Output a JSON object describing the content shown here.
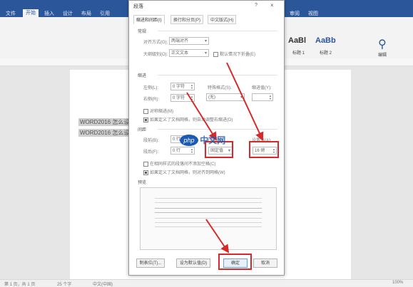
{
  "ribbon": {
    "tabs": [
      "文件",
      "开始",
      "插入",
      "设计",
      "布局",
      "引用",
      "邮件",
      "审阅",
      "视图"
    ],
    "active_tab": "开始",
    "styles": [
      {
        "sample": "AaBl",
        "caption": "标题 1"
      },
      {
        "sample": "AaBb",
        "caption": "标题 2"
      }
    ],
    "right_button": "编辑"
  },
  "document": {
    "lines": [
      "WORD2016 怎么设",
      "WORD2016 怎么设"
    ]
  },
  "dialog": {
    "title": "段落",
    "help": "?",
    "close": "×",
    "tabs": [
      "缩进和间距(I)",
      "换行和分页(P)",
      "中文版式(H)"
    ],
    "general": {
      "section": "常规",
      "alignment_label": "对齐方式(G):",
      "alignment_value": "两端对齐",
      "outline_label": "大纲级别(O):",
      "outline_value": "正文文本",
      "collapse_label": "默认情况下折叠(E)"
    },
    "indent": {
      "section": "缩进",
      "left_label": "左侧(L):",
      "left_value": "0 字符",
      "right_label": "右侧(R):",
      "right_value": "0 字符",
      "special_label": "特殊格式(S):",
      "special_value": "(无)",
      "by_label": "缩进值(Y):",
      "mirror_label": "对称缩进(M)",
      "grid_label": "如果定义了文档网格，则自动调整右缩进(D)"
    },
    "spacing": {
      "section": "间距",
      "before_label": "段前(B):",
      "before_value": "0 行",
      "after_label": "段后(F):",
      "after_value": "0 行",
      "line_label": "行距(N):",
      "line_value": "固定值",
      "at_label": "设置值(A):",
      "at_value": "16 磅",
      "no_space_label": "在相同样式的段落间不添加空格(C)",
      "snap_label": "如果定义了文档网格，则对齐到网格(W)"
    },
    "preview": {
      "section": "预览"
    },
    "buttons": {
      "tabs": "制表位(T)...",
      "default": "设为默认值(D)",
      "ok": "确定",
      "cancel": "取消"
    }
  },
  "statusbar": {
    "page": "第 1 页，共 1 页",
    "words": "25 个字",
    "lang": "中文(中国)",
    "zoom": "100%"
  },
  "watermark": {
    "logo": "php",
    "text": "中文网"
  },
  "colors": {
    "accent": "#2b579a",
    "annotation": "#d62a2a"
  }
}
